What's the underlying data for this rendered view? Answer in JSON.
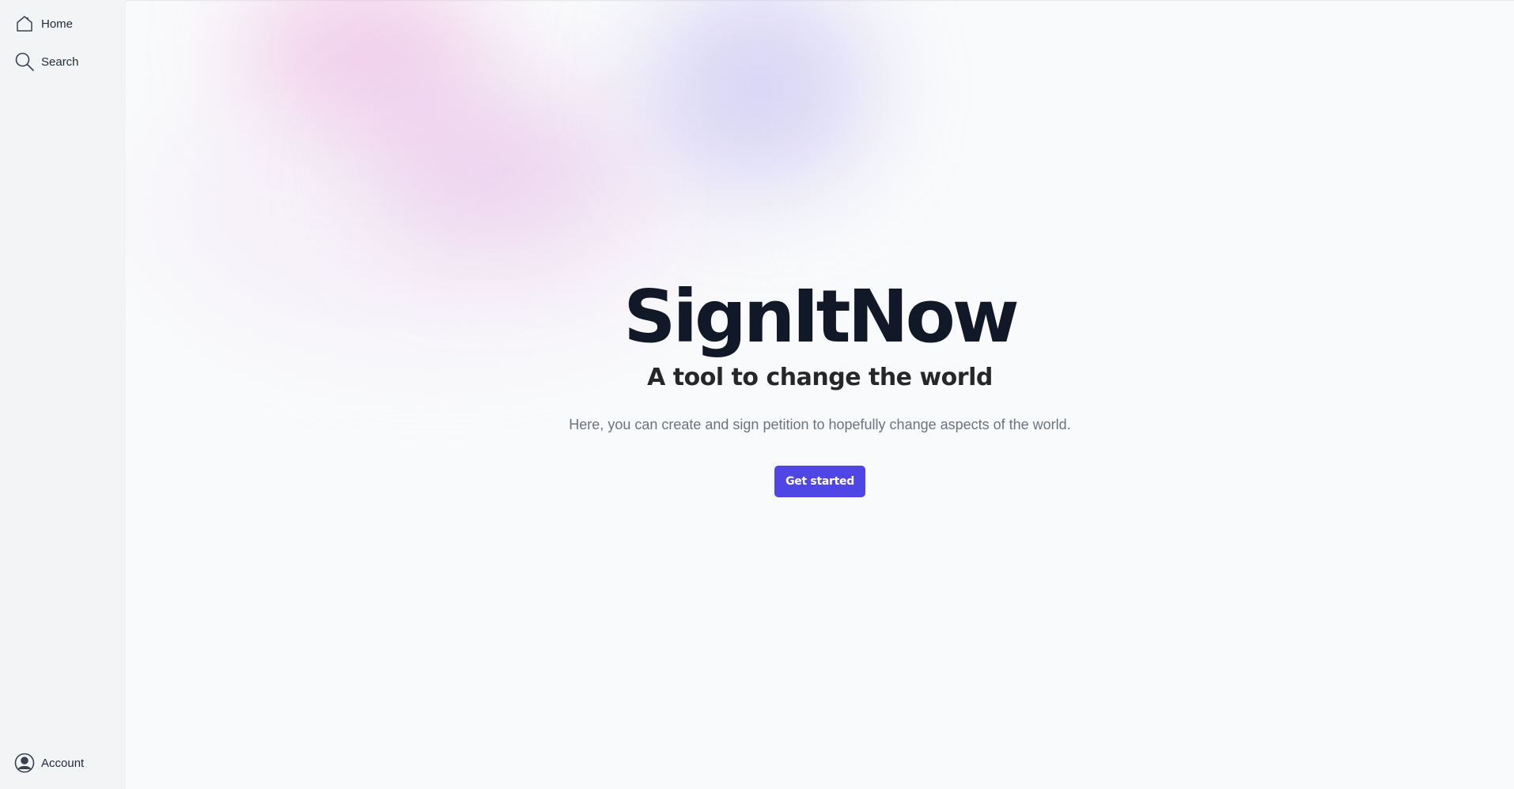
{
  "sidebar": {
    "items": [
      {
        "label": "Home",
        "icon": "home-icon"
      },
      {
        "label": "Search",
        "icon": "search-icon"
      }
    ],
    "account": {
      "label": "Account",
      "icon": "account-icon"
    }
  },
  "hero": {
    "title": "SignItNow",
    "subtitle": "A tool to change the world",
    "description": "Here, you can create and sign petition to hopefully change aspects of the world.",
    "cta_label": "Get started"
  },
  "colors": {
    "accent": "#4f46e5",
    "title": "#111827",
    "sidebar_bg": "#f3f4f6",
    "page_bg": "#f9fafb"
  }
}
